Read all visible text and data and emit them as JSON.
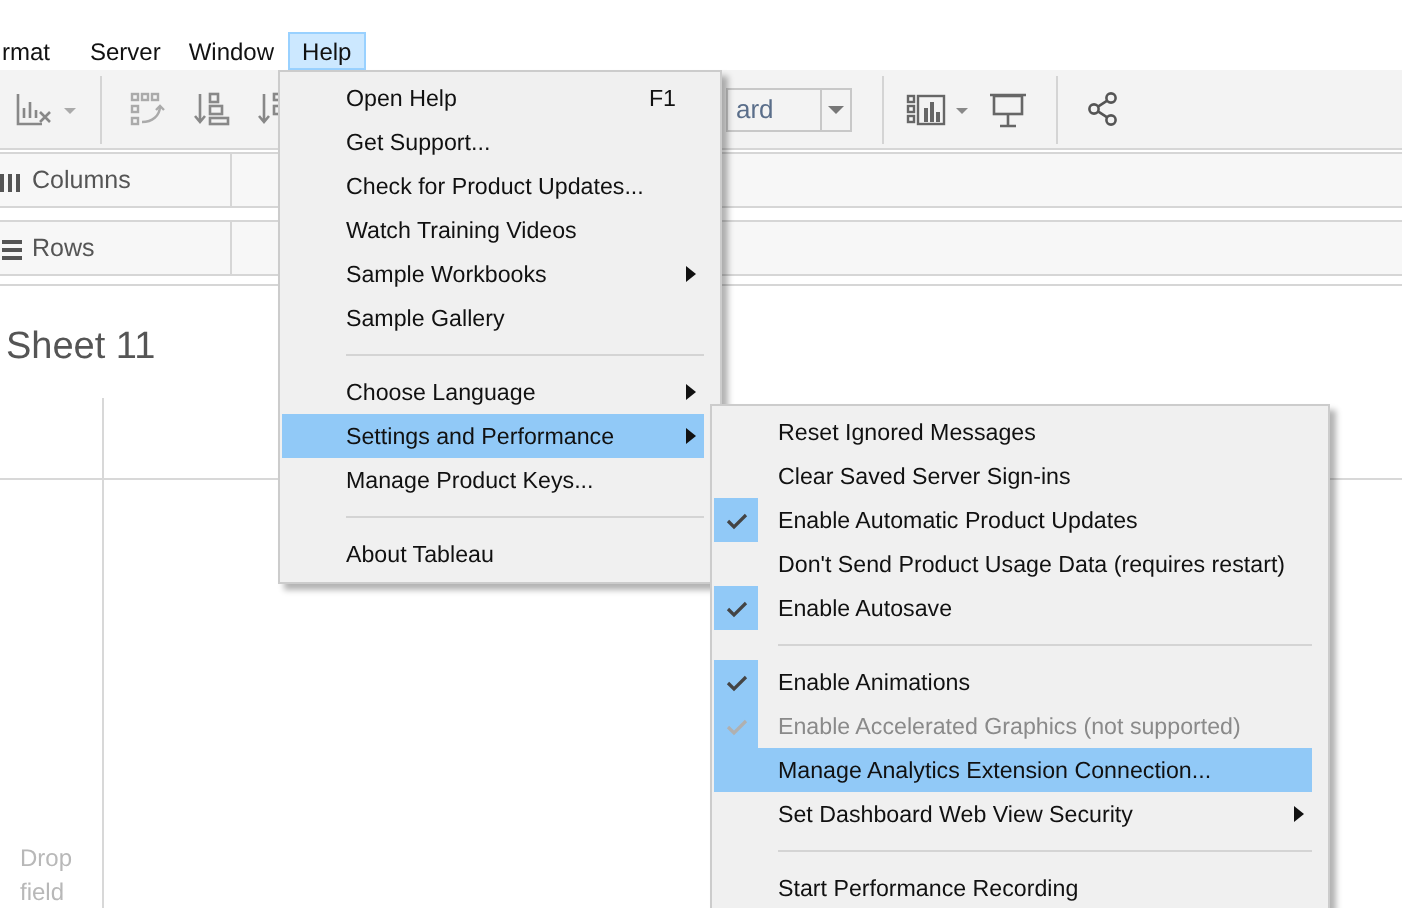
{
  "menubar": [
    {
      "label": "rmat",
      "selected": false
    },
    {
      "label": "Server",
      "selected": false
    },
    {
      "label": "Window",
      "selected": false
    },
    {
      "label": "Help",
      "selected": true
    }
  ],
  "toolbar": {
    "view_dropdown": {
      "value": "ard"
    }
  },
  "shelves": [
    {
      "kind": "columns",
      "label": "Columns"
    },
    {
      "kind": "rows",
      "label": "Rows"
    }
  ],
  "sheet": {
    "title": "Sheet 11",
    "drop_hint": "Drop field"
  },
  "help_menu": [
    {
      "kind": "item",
      "label": "Open Help",
      "shortcut": "F1",
      "submenu": false,
      "selected": false
    },
    {
      "kind": "item",
      "label": "Get Support...",
      "submenu": false,
      "selected": false
    },
    {
      "kind": "item",
      "label": "Check for Product Updates...",
      "submenu": false,
      "selected": false
    },
    {
      "kind": "item",
      "label": "Watch Training Videos",
      "submenu": false,
      "selected": false
    },
    {
      "kind": "item",
      "label": "Sample Workbooks",
      "submenu": true,
      "selected": false
    },
    {
      "kind": "item",
      "label": "Sample Gallery",
      "submenu": false,
      "selected": false
    },
    {
      "kind": "separator"
    },
    {
      "kind": "item",
      "label": "Choose Language",
      "submenu": true,
      "selected": false
    },
    {
      "kind": "item",
      "label": "Settings and Performance",
      "submenu": true,
      "selected": true
    },
    {
      "kind": "item",
      "label": "Manage Product Keys...",
      "submenu": false,
      "selected": false
    },
    {
      "kind": "separator"
    },
    {
      "kind": "item",
      "label": "About Tableau",
      "submenu": false,
      "selected": false
    }
  ],
  "settings_submenu": [
    {
      "kind": "item",
      "label": "Reset Ignored Messages",
      "submenu": false,
      "selected": false,
      "checked": false,
      "disabled": false
    },
    {
      "kind": "item",
      "label": "Clear Saved Server Sign-ins",
      "submenu": false,
      "selected": false,
      "checked": false,
      "disabled": false
    },
    {
      "kind": "item",
      "label": "Enable Automatic Product Updates",
      "submenu": false,
      "selected": false,
      "checked": true,
      "disabled": false
    },
    {
      "kind": "item",
      "label": "Don't Send Product Usage Data (requires restart)",
      "submenu": false,
      "selected": false,
      "checked": false,
      "disabled": false
    },
    {
      "kind": "item",
      "label": "Enable Autosave",
      "submenu": false,
      "selected": false,
      "checked": true,
      "disabled": false
    },
    {
      "kind": "separator"
    },
    {
      "kind": "item",
      "label": "Enable Animations",
      "submenu": false,
      "selected": false,
      "checked": true,
      "disabled": false
    },
    {
      "kind": "item",
      "label": "Enable Accelerated Graphics (not supported)",
      "submenu": false,
      "selected": false,
      "checked": true,
      "disabled": true
    },
    {
      "kind": "item",
      "label": "Manage Analytics Extension Connection...",
      "submenu": false,
      "selected": true,
      "checked": false,
      "disabled": false
    },
    {
      "kind": "item",
      "label": "Set Dashboard Web View Security",
      "submenu": true,
      "selected": false,
      "checked": false,
      "disabled": false
    },
    {
      "kind": "separator"
    },
    {
      "kind": "item",
      "label": "Start Performance Recording",
      "submenu": false,
      "selected": false,
      "checked": false,
      "disabled": false
    }
  ]
}
